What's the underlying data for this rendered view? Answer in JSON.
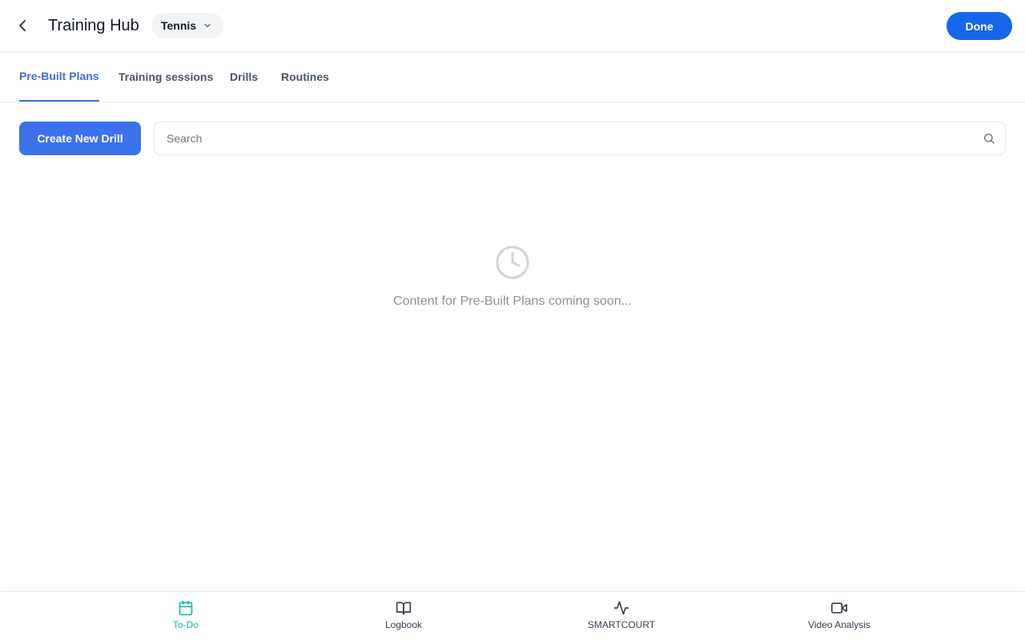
{
  "header": {
    "title": "Training Hub",
    "sport_selected": "Tennis",
    "done_label": "Done"
  },
  "tabs": [
    {
      "label": "Pre-Built Plans",
      "active": true
    },
    {
      "label": "Training sessions",
      "active": false
    },
    {
      "label": "Drills",
      "active": false
    },
    {
      "label": "Routines",
      "active": false
    }
  ],
  "toolbar": {
    "create_label": "Create New Drill",
    "search_placeholder": "Search"
  },
  "empty_state": {
    "icon": "clock-icon",
    "message": "Content for Pre-Built Plans coming soon..."
  },
  "bottom_nav": [
    {
      "label": "To-Do",
      "icon": "calendar-icon",
      "active": true
    },
    {
      "label": "Logbook",
      "icon": "book-icon",
      "active": false
    },
    {
      "label": "SMARTCOURT",
      "icon": "activity-icon",
      "active": false
    },
    {
      "label": "Video Analysis",
      "icon": "video-icon",
      "active": false
    }
  ],
  "colors": {
    "primary": "#1666ec",
    "tab_active": "#3b6fdb",
    "nav_active": "#14b8a6",
    "muted_text": "#8b919c"
  }
}
